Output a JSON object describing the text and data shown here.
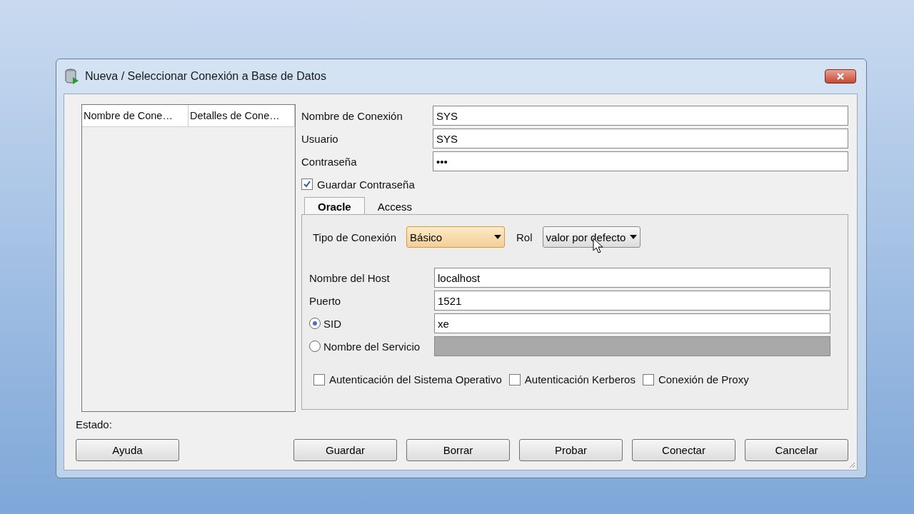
{
  "window": {
    "title": "Nueva / Seleccionar Conexión a Base de Datos"
  },
  "connection_list": {
    "columns": [
      "Nombre de Cone…",
      "Detalles de Cone…"
    ]
  },
  "fields": [
    {
      "label": "Nombre de Conexión",
      "value": "SYS"
    },
    {
      "label": "Usuario",
      "value": "SYS"
    },
    {
      "label": "Contraseña",
      "value": "•••"
    }
  ],
  "save_password": {
    "label": "Guardar Contraseña",
    "checked": true
  },
  "tabs": [
    {
      "label": "Oracle",
      "selected": true
    },
    {
      "label": "Access",
      "selected": false
    }
  ],
  "connection_type": {
    "label": "Tipo de Conexión",
    "value": "Básico",
    "focused": true
  },
  "role": {
    "label": "Rol",
    "value": "valor por defecto"
  },
  "host_fields": [
    {
      "kind": "text",
      "label": "Nombre del Host",
      "value": "localhost",
      "disabled": false
    },
    {
      "kind": "text",
      "label": "Puerto",
      "value": "1521",
      "disabled": false
    },
    {
      "kind": "radio",
      "label": "SID",
      "value": "xe",
      "selected": true,
      "disabled": false
    },
    {
      "kind": "radio",
      "label": "Nombre del Servicio",
      "selected": false,
      "disabled": true
    }
  ],
  "options": [
    {
      "label": "Autenticación del Sistema Operativo",
      "checked": false
    },
    {
      "label": "Autenticación Kerberos",
      "checked": false
    },
    {
      "label": "Conexión de Proxy",
      "checked": false
    }
  ],
  "status": {
    "label": "Estado:"
  },
  "help_button": {
    "label": "Ayuda"
  },
  "buttons": [
    {
      "label": "Guardar"
    },
    {
      "label": "Borrar"
    },
    {
      "label": "Probar"
    },
    {
      "label": "Conectar"
    },
    {
      "label": "Cancelar"
    }
  ]
}
